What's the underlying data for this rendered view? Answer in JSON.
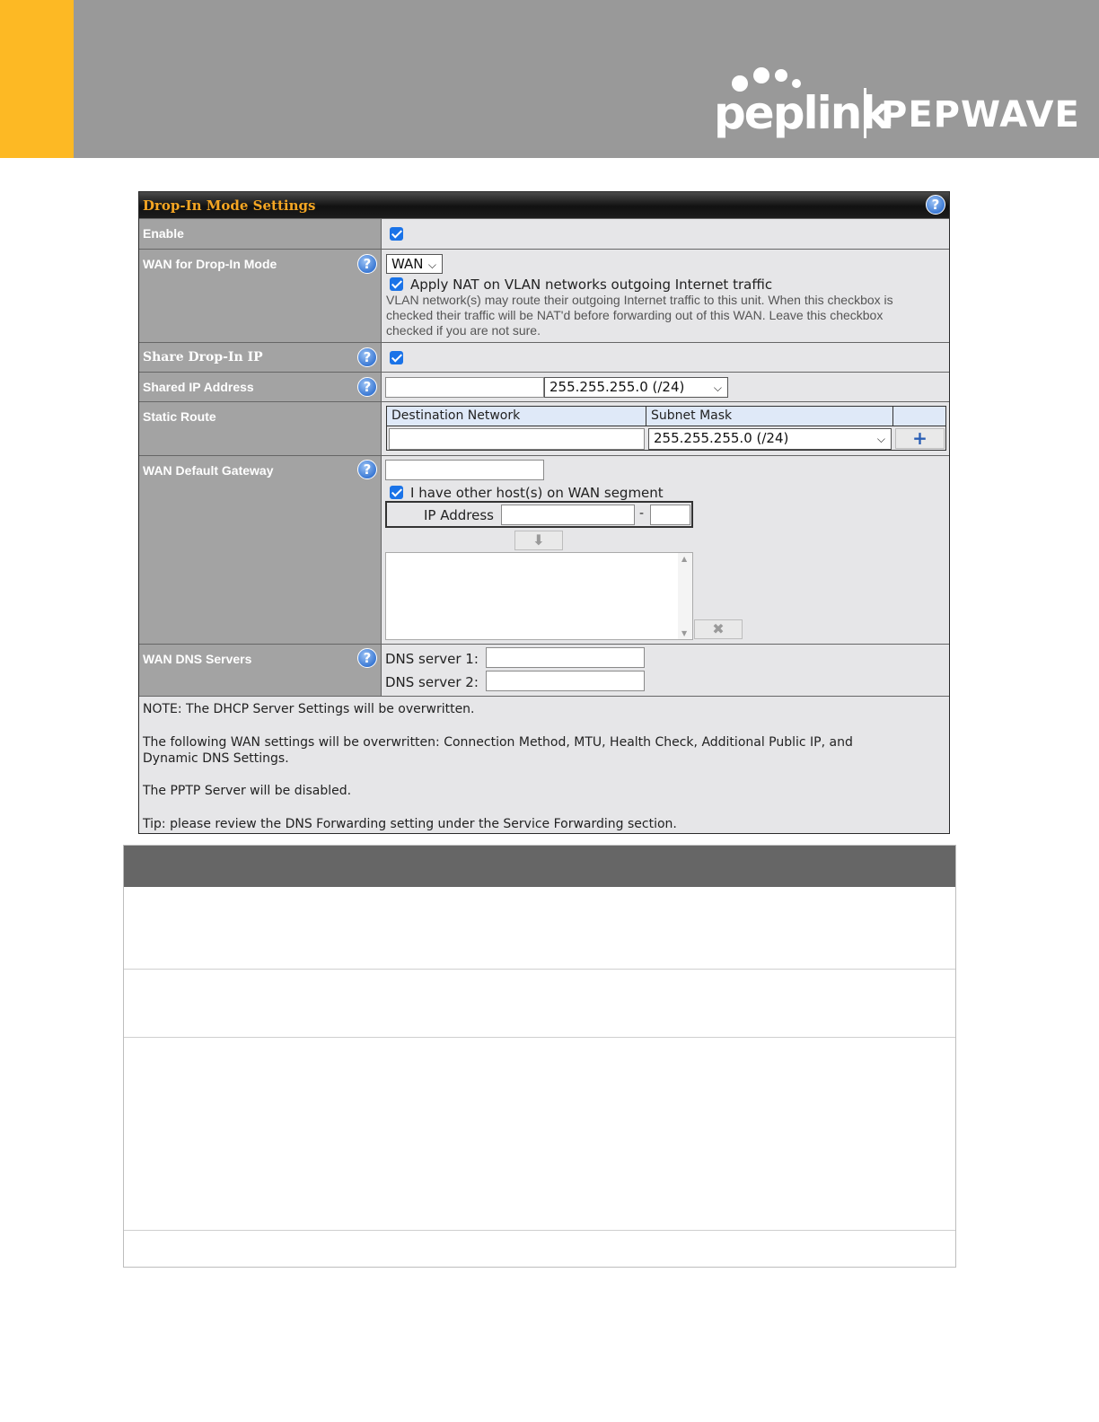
{
  "brand": {
    "logo_text": "peplink",
    "brand_text": "PEPWAVE",
    "accent_color": "#FDB924",
    "header_color": "#999999"
  },
  "panel": {
    "title": "Drop-In Mode Settings",
    "enable_label": "Enable",
    "enable_checked": true,
    "wan_label": "WAN for Drop-In Mode",
    "wan_select": "WAN",
    "nat_label": "Apply NAT on VLAN networks outgoing Internet traffic",
    "nat_checked": true,
    "nat_help_1": "VLAN network(s) may route their outgoing Internet traffic to this unit. When this checkbox is",
    "nat_help_2": "checked their traffic will be NAT'd before forwarding out of this WAN. Leave this checkbox",
    "nat_help_3": "checked if you are not sure.",
    "share_label": "Share Drop-In IP",
    "share_checked": true,
    "shared_ip_label": "Shared IP Address",
    "shared_ip_value": "",
    "shared_mask": "255.255.255.0 (/24)",
    "static_route_label": "Static Route",
    "col_dest": "Destination Network",
    "col_mask": "Subnet Mask",
    "route_mask": "255.255.255.0 (/24)",
    "add_icon": "plus-icon",
    "gateway_label": "WAN Default Gateway",
    "other_hosts_label": "I have other host(s) on WAN segment",
    "other_hosts_checked": true,
    "ip_address_label": "IP Address",
    "range_sep": "-",
    "dns_label": "WAN DNS Servers",
    "dns1_label": "DNS server 1:",
    "dns2_label": "DNS server 2:",
    "note_1": "NOTE: The DHCP Server Settings will be overwritten.",
    "note_2a": "The following WAN settings will be overwritten: Connection Method, MTU, Health Check, Additional Public IP, and",
    "note_2b": "Dynamic DNS Settings.",
    "note_3": "The PPTP Server will be disabled.",
    "note_4": "Tip: please review the DNS Forwarding setting under the Service Forwarding section.",
    "help_glyph": "?"
  }
}
